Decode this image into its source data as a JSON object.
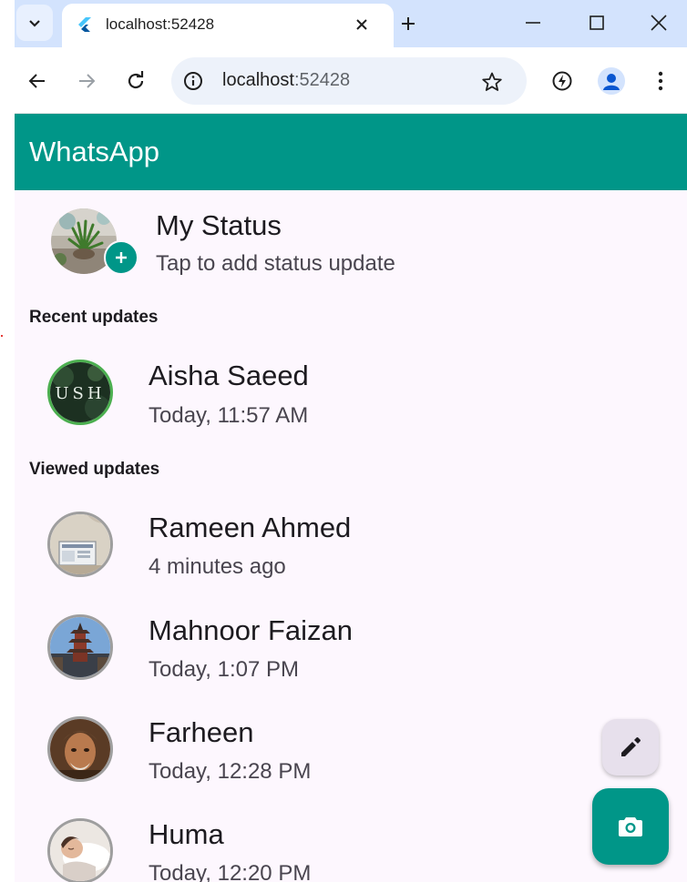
{
  "browser": {
    "tab_title": "localhost:52428",
    "url_host": "localhost",
    "url_port": ":52428"
  },
  "app": {
    "title": "WhatsApp"
  },
  "my_status": {
    "title": "My Status",
    "subtitle": "Tap to add status update"
  },
  "sections": {
    "recent": "Recent updates",
    "viewed": "Viewed updates"
  },
  "recent_updates": [
    {
      "name": "Aisha Saeed",
      "time": "Today, 11:57 AM"
    }
  ],
  "viewed_updates": [
    {
      "name": "Rameen Ahmed",
      "time": "4 minutes ago"
    },
    {
      "name": "Mahnoor Faizan",
      "time": "Today, 1:07 PM"
    },
    {
      "name": "Farheen",
      "time": "Today, 12:28 PM"
    },
    {
      "name": "Huma",
      "time": "Today, 12:20 PM"
    }
  ],
  "colors": {
    "brand": "#009688",
    "recent_ring": "#4caf50",
    "viewed_ring": "#9e9e9e",
    "background": "#fdf7fe"
  },
  "icons": {
    "tab_search": "chevron-down-icon",
    "favicon": "flutter-icon",
    "close_tab": "close-icon",
    "new_tab": "plus-icon",
    "back": "arrow-left-icon",
    "forward": "arrow-right-icon",
    "reload": "reload-icon",
    "site_info": "info-icon",
    "bookmark": "star-icon",
    "performance": "lightning-icon",
    "profile": "person-icon",
    "menu": "more-vert-icon",
    "add_status": "plus-icon",
    "edit": "pencil-icon",
    "camera": "camera-icon"
  }
}
